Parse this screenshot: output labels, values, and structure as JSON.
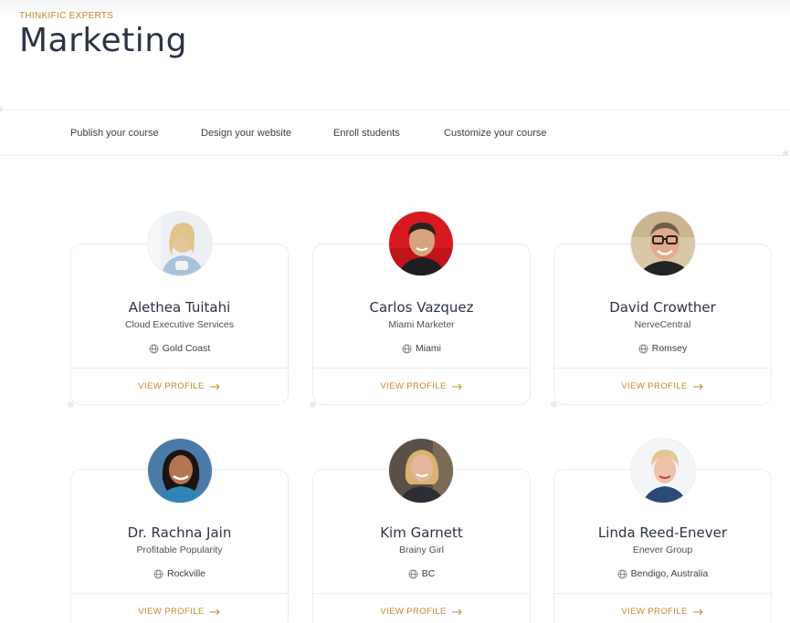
{
  "header": {
    "eyebrow": "THINKIFIC EXPERTS",
    "title": "Marketing"
  },
  "nav": {
    "items": [
      {
        "label": "Publish your course"
      },
      {
        "label": "Design your website"
      },
      {
        "label": "Enroll students"
      },
      {
        "label": "Customize your course"
      }
    ]
  },
  "experts": [
    {
      "name": "Alethea Tuitahi",
      "company": "Cloud Executive Services",
      "location": "Gold Coast",
      "link": "VIEW PROFILE",
      "avatar": "woman-blonde-avatar"
    },
    {
      "name": "Carlos Vazquez",
      "company": "Miami Marketer",
      "location": "Miami",
      "link": "VIEW PROFILE",
      "avatar": "man-red-background-avatar"
    },
    {
      "name": "David Crowther",
      "company": "NerveCentral",
      "location": "Romsey",
      "link": "VIEW PROFILE",
      "avatar": "man-glasses-avatar"
    },
    {
      "name": "Dr. Rachna Jain",
      "company": "Profitable Popularity",
      "location": "Rockville",
      "link": "VIEW PROFILE",
      "avatar": "woman-dark-hair-avatar"
    },
    {
      "name": "Kim Garnett",
      "company": "Brainy Girl",
      "location": "BC",
      "link": "VIEW PROFILE",
      "avatar": "woman-blonde-dark-background-avatar"
    },
    {
      "name": "Linda Reed-Enever",
      "company": "Enever Group",
      "location": "Bendigo, Australia",
      "link": "VIEW PROFILE",
      "avatar": "woman-short-blonde-avatar"
    }
  ],
  "colors": {
    "accent": "#c8872e",
    "title": "#2b3446",
    "border": "#ececec"
  }
}
